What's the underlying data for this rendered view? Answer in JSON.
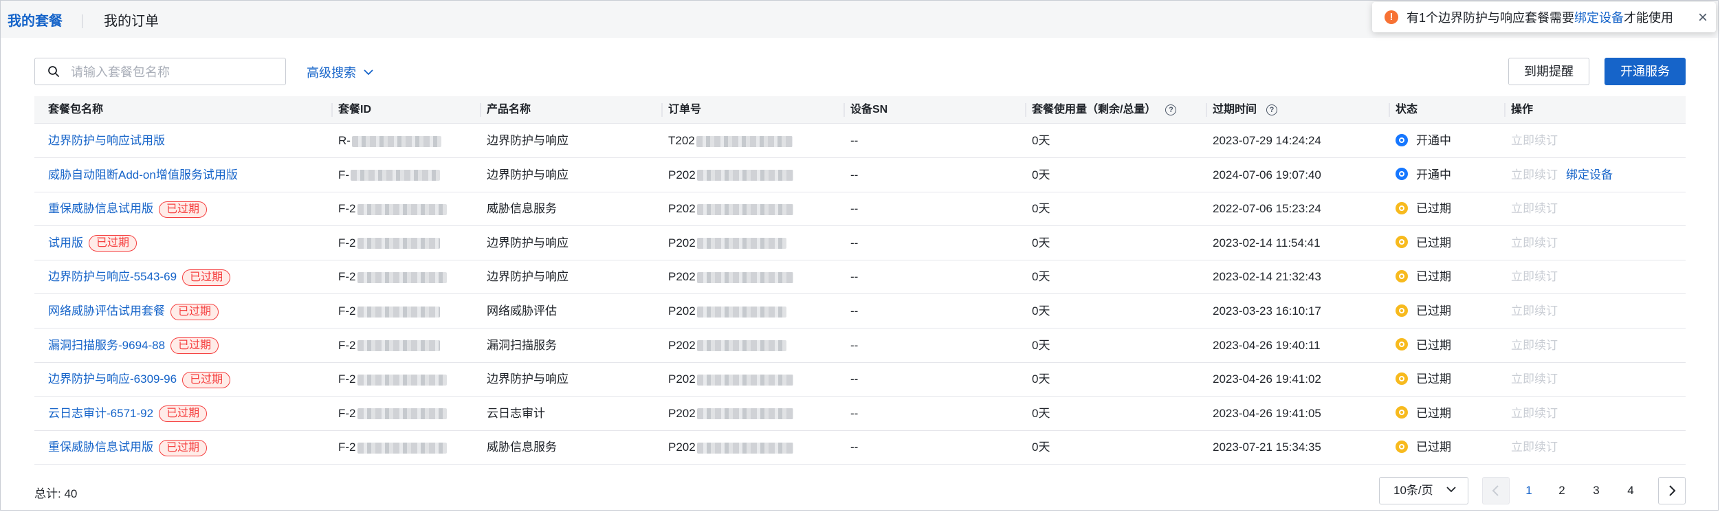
{
  "tabs": {
    "my_packages": "我的套餐",
    "my_orders": "我的订单"
  },
  "notice": {
    "text_before": "有1个边界防护与响应套餐需要",
    "link": "绑定设备",
    "text_after": "才能使用",
    "close": "×"
  },
  "search": {
    "placeholder": "请输入套餐包名称",
    "value": ""
  },
  "advanced_search": "高级搜索",
  "buttons": {
    "expire_remind": "到期提醒",
    "open_service": "开通服务"
  },
  "table": {
    "headers": {
      "name": "套餐包名称",
      "package_id": "套餐ID",
      "product": "产品名称",
      "order_no": "订单号",
      "device_sn": "设备SN",
      "usage": "套餐使用量（剩余/总量）",
      "expire_time": "过期时间",
      "status": "状态",
      "actions": "操作"
    },
    "rows": [
      {
        "name": "边界防护与响应试用版",
        "tag": "",
        "id_prefix": "R-",
        "product": "边界防护与响应",
        "order_prefix": "T202",
        "sn": "--",
        "usage": "0天",
        "expire": "2023-07-29 14:24:24",
        "status": "开通中",
        "status_type": "active",
        "renew": "立即续订",
        "bind": ""
      },
      {
        "name": "威胁自动阻断Add-on增值服务试用版",
        "tag": "",
        "id_prefix": "F-",
        "product": "边界防护与响应",
        "order_prefix": "P202",
        "sn": "--",
        "usage": "0天",
        "expire": "2024-07-06 19:07:40",
        "status": "开通中",
        "status_type": "active",
        "renew": "立即续订",
        "bind": "绑定设备"
      },
      {
        "name": "重保威胁信息试用版",
        "tag": "已过期",
        "id_prefix": "F-2",
        "product": "威胁信息服务",
        "order_prefix": "P202",
        "sn": "--",
        "usage": "0天",
        "expire": "2022-07-06 15:23:24",
        "status": "已过期",
        "status_type": "expired",
        "renew": "立即续订",
        "bind": ""
      },
      {
        "name": "试用版",
        "tag": "已过期",
        "id_prefix": "F-2",
        "product": "边界防护与响应",
        "order_prefix": "P202",
        "sn": "--",
        "usage": "0天",
        "expire": "2023-02-14 11:54:41",
        "status": "已过期",
        "status_type": "expired",
        "renew": "立即续订",
        "bind": ""
      },
      {
        "name": "边界防护与响应-5543-69",
        "tag": "已过期",
        "id_prefix": "F-2",
        "product": "边界防护与响应",
        "order_prefix": "P202",
        "sn": "--",
        "usage": "0天",
        "expire": "2023-02-14 21:32:43",
        "status": "已过期",
        "status_type": "expired",
        "renew": "立即续订",
        "bind": ""
      },
      {
        "name": "网络威胁评估试用套餐",
        "tag": "已过期",
        "id_prefix": "F-2",
        "product": "网络威胁评估",
        "order_prefix": "P202",
        "sn": "--",
        "usage": "0天",
        "expire": "2023-03-23 16:10:17",
        "status": "已过期",
        "status_type": "expired",
        "renew": "立即续订",
        "bind": ""
      },
      {
        "name": "漏洞扫描服务-9694-88",
        "tag": "已过期",
        "id_prefix": "F-2",
        "product": "漏洞扫描服务",
        "order_prefix": "P202",
        "sn": "--",
        "usage": "0天",
        "expire": "2023-04-26 19:40:11",
        "status": "已过期",
        "status_type": "expired",
        "renew": "立即续订",
        "bind": ""
      },
      {
        "name": "边界防护与响应-6309-96",
        "tag": "已过期",
        "id_prefix": "F-2",
        "product": "边界防护与响应",
        "order_prefix": "P202",
        "sn": "--",
        "usage": "0天",
        "expire": "2023-04-26 19:41:02",
        "status": "已过期",
        "status_type": "expired",
        "renew": "立即续订",
        "bind": ""
      },
      {
        "name": "云日志审计-6571-92",
        "tag": "已过期",
        "id_prefix": "F-2",
        "product": "云日志审计",
        "order_prefix": "P202",
        "sn": "--",
        "usage": "0天",
        "expire": "2023-04-26 19:41:05",
        "status": "已过期",
        "status_type": "expired",
        "renew": "立即续订",
        "bind": ""
      },
      {
        "name": "重保威胁信息试用版",
        "tag": "已过期",
        "id_prefix": "F-2",
        "product": "威胁信息服务",
        "order_prefix": "P202",
        "sn": "--",
        "usage": "0天",
        "expire": "2023-07-21 15:34:35",
        "status": "已过期",
        "status_type": "expired",
        "renew": "立即续订",
        "bind": ""
      }
    ]
  },
  "footer": {
    "total": "总计: 40",
    "page_size": "10条/页",
    "pages": [
      "1",
      "2",
      "3",
      "4"
    ],
    "current_page": "1"
  },
  "colors": {
    "primary": "#1664c9",
    "expired_tag": "#f53f3f",
    "status_active": "#1677ff",
    "status_expired": "#f7ba1e"
  }
}
